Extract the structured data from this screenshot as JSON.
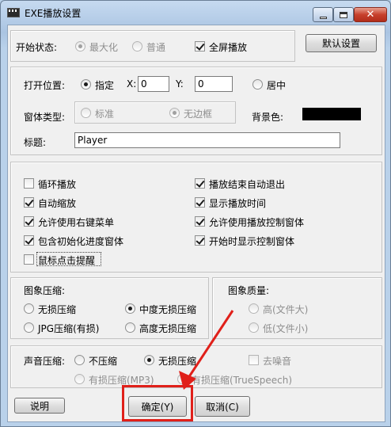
{
  "window": {
    "title": "EXE播放设置",
    "close_glyph": "✕",
    "icons": {
      "minimize": "minimize-icon",
      "maximize": "maximize-icon",
      "close": "close-icon"
    }
  },
  "start": {
    "label": "开始状态:",
    "maximize": "最大化",
    "normal": "普通",
    "fullscreen": "全屏播放",
    "default_button": "默认设置"
  },
  "position": {
    "label": "打开位置:",
    "specified": "指定",
    "x_label": "X:",
    "x_value": "0",
    "y_label": "Y:",
    "y_value": "0",
    "center": "居中"
  },
  "window_type": {
    "label": "窗体类型:",
    "standard": "标准",
    "borderless": "无边框",
    "bg_label": "背景色:",
    "bg_color": "#000000"
  },
  "title_field": {
    "label": "标题:",
    "value": "Player"
  },
  "options": {
    "loop": "循环播放",
    "auto_exit": "播放结束自动退出",
    "auto_zoom": "自动缩放",
    "show_time": "显示播放时间",
    "right_menu": "允许使用右键菜单",
    "allow_control": "允许使用播放控制窗体",
    "init_progress": "包含初始化进度窗体",
    "show_control_start": "开始时显示控制窗体",
    "click_prompt": "鼠标点击提醒"
  },
  "image_compress": {
    "label": "图象压缩:",
    "lossless": "无损压缩",
    "medium_lossless": "中度无损压缩",
    "jpg": "JPG压缩(有损)",
    "high_lossless": "高度无损压缩"
  },
  "image_quality": {
    "label": "图象质量:",
    "high": "高(文件大)",
    "low": "低(文件小)"
  },
  "audio": {
    "label": "声音压缩:",
    "none": "不压缩",
    "lossless": "无损压缩",
    "denoise": "去噪音",
    "mp3": "有损压缩(MP3)",
    "truespeech": "有损压缩(TrueSpeech)"
  },
  "buttons": {
    "help": "说明",
    "ok": "确定(Y)",
    "cancel": "取消(C)"
  },
  "annotation": {
    "color": "#e0201a"
  }
}
